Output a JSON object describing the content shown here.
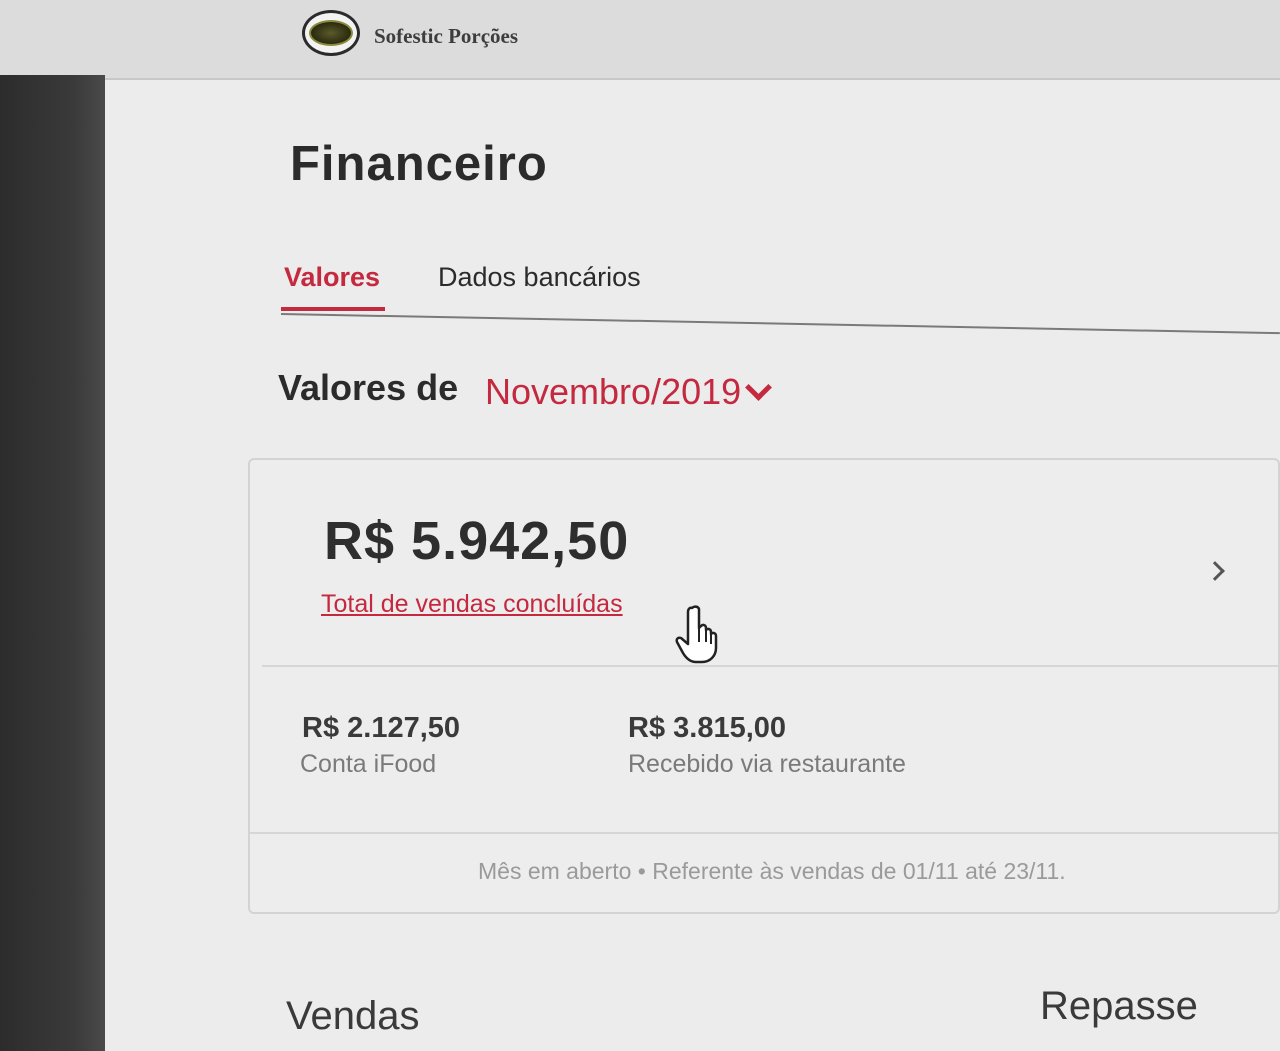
{
  "header": {
    "restaurant_name": "Sofestic Porções"
  },
  "page": {
    "title": "Financeiro"
  },
  "tabs": [
    {
      "label": "Valores",
      "active": true
    },
    {
      "label": "Dados bancários",
      "active": false
    }
  ],
  "period": {
    "prefix": "Valores de",
    "selected_month": "Novembro/2019"
  },
  "summary": {
    "total_value": "R$ 5.942,50",
    "total_label": "Total de vendas concluídas",
    "breakdown": [
      {
        "value": "R$ 2.127,50",
        "label": "Conta iFood"
      },
      {
        "value": "R$ 3.815,00",
        "label": "Recebido via restaurante"
      }
    ],
    "footnote": "Mês em aberto • Referente às vendas de 01/11 até 23/11."
  },
  "sections": {
    "left": "Vendas",
    "right": "Repasse"
  },
  "colors": {
    "accent": "#c4293f",
    "text": "#2b2b2b",
    "muted": "#7a7a7a"
  }
}
